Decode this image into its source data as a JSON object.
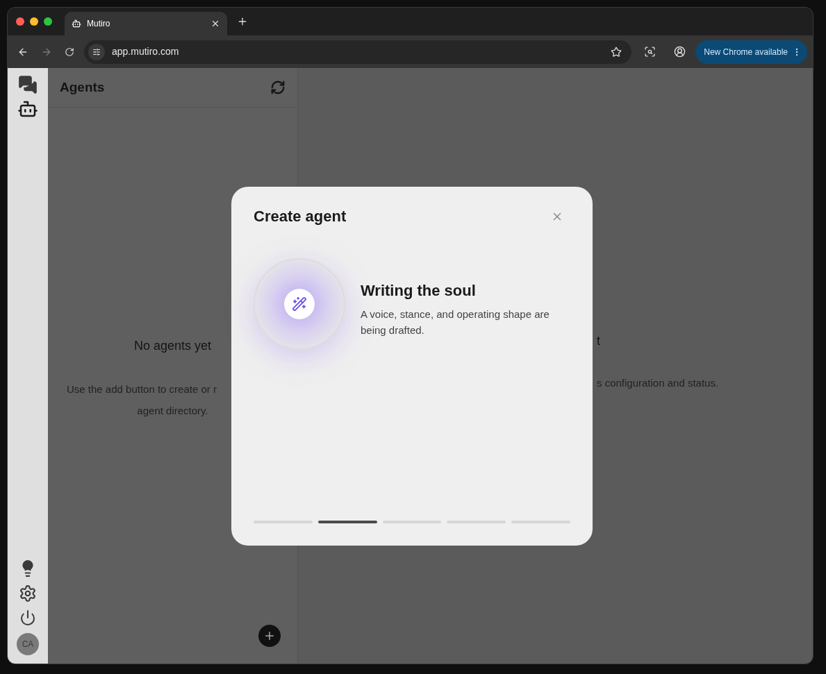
{
  "browser": {
    "tab": {
      "title": "Mutiro"
    },
    "address": "app.mutiro.com",
    "update_button": "New Chrome available"
  },
  "sidebar": {
    "avatar": "CA"
  },
  "agents_panel": {
    "title": "Agents",
    "empty_title": "No agents yet",
    "empty_lines": [
      "Use the add button to create or r",
      "agent directory."
    ]
  },
  "detail_pane": {
    "title": "t",
    "description": "s configuration and status."
  },
  "dialog": {
    "title": "Create agent",
    "step_title": "Writing the soul",
    "step_description": "A voice, stance, and operating shape are being drafted.",
    "steps": [
      {
        "selected": false
      },
      {
        "selected": true
      },
      {
        "selected": false
      },
      {
        "selected": false
      },
      {
        "selected": false
      }
    ]
  }
}
